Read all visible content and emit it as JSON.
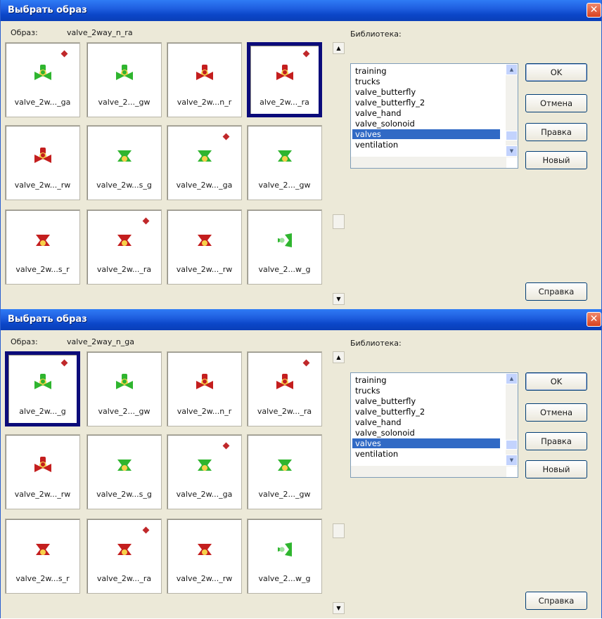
{
  "dialogs": [
    {
      "title": "Выбрать образ",
      "image_label": "Образ:",
      "image_value": "valve_2way_n_ra",
      "library_label": "Библиотека:",
      "tiles": [
        {
          "caption": "valve_2w..._ga",
          "icon": "green-valve",
          "marked": true,
          "selected": false
        },
        {
          "caption": "valve_2..._gw",
          "icon": "green-valve",
          "marked": false,
          "selected": false
        },
        {
          "caption": "valve_2w...n_r",
          "icon": "red-valve",
          "marked": false,
          "selected": false
        },
        {
          "caption": "alve_2w..._ra",
          "icon": "red-valve",
          "marked": true,
          "selected": true
        },
        {
          "caption": "valve_2w..._rw",
          "icon": "red-valve",
          "marked": false,
          "selected": false
        },
        {
          "caption": "valve_2w...s_g",
          "icon": "green-valve-bowtie",
          "marked": false,
          "selected": false
        },
        {
          "caption": "valve_2w..._ga",
          "icon": "green-valve-bowtie",
          "marked": true,
          "selected": false
        },
        {
          "caption": "valve_2..._gw",
          "icon": "green-valve-bowtie",
          "marked": false,
          "selected": false
        },
        {
          "caption": "valve_2w...s_r",
          "icon": "red-valve-bowtie",
          "marked": false,
          "selected": false
        },
        {
          "caption": "valve_2w..._ra",
          "icon": "red-valve-bowtie",
          "marked": true,
          "selected": false
        },
        {
          "caption": "valve_2w..._rw",
          "icon": "red-valve-bowtie",
          "marked": false,
          "selected": false
        },
        {
          "caption": "valve_2...w_g",
          "icon": "green-valve-side",
          "marked": false,
          "selected": false
        }
      ],
      "library": [
        "training",
        "trucks",
        "valve_butterfly",
        "valve_butterfly_2",
        "valve_hand",
        "valve_solonoid",
        "valves",
        "ventilation"
      ],
      "library_selected": "valves",
      "buttons": {
        "ok": "OK",
        "cancel": "Отмена",
        "edit": "Правка",
        "new": "Новый",
        "help": "Справка"
      }
    },
    {
      "title": "Выбрать образ",
      "image_label": "Образ:",
      "image_value": "valve_2way_n_ga",
      "library_label": "Библиотека:",
      "tiles": [
        {
          "caption": "alve_2w..._g",
          "icon": "green-valve",
          "marked": true,
          "selected": true
        },
        {
          "caption": "valve_2..._gw",
          "icon": "green-valve",
          "marked": false,
          "selected": false
        },
        {
          "caption": "valve_2w...n_r",
          "icon": "red-valve",
          "marked": false,
          "selected": false
        },
        {
          "caption": "valve_2w..._ra",
          "icon": "red-valve",
          "marked": true,
          "selected": false
        },
        {
          "caption": "valve_2w..._rw",
          "icon": "red-valve",
          "marked": false,
          "selected": false
        },
        {
          "caption": "valve_2w...s_g",
          "icon": "green-valve-bowtie",
          "marked": false,
          "selected": false
        },
        {
          "caption": "valve_2w..._ga",
          "icon": "green-valve-bowtie",
          "marked": true,
          "selected": false
        },
        {
          "caption": "valve_2..._gw",
          "icon": "green-valve-bowtie",
          "marked": false,
          "selected": false
        },
        {
          "caption": "valve_2w...s_r",
          "icon": "red-valve-bowtie",
          "marked": false,
          "selected": false
        },
        {
          "caption": "valve_2w..._ra",
          "icon": "red-valve-bowtie",
          "marked": true,
          "selected": false
        },
        {
          "caption": "valve_2w..._rw",
          "icon": "red-valve-bowtie",
          "marked": false,
          "selected": false
        },
        {
          "caption": "valve_2...w_g",
          "icon": "green-valve-side",
          "marked": false,
          "selected": false
        }
      ],
      "library": [
        "training",
        "trucks",
        "valve_butterfly",
        "valve_butterfly_2",
        "valve_hand",
        "valve_solonoid",
        "valves",
        "ventilation"
      ],
      "library_selected": "valves",
      "buttons": {
        "ok": "OK",
        "cancel": "Отмена",
        "edit": "Правка",
        "new": "Новый",
        "help": "Справка"
      }
    }
  ],
  "colors": {
    "green": "#2fb52f",
    "red": "#c41e1e",
    "highlight": "#316ac5",
    "selection_border": "#0b0b7a",
    "marker": "#c0282a"
  }
}
